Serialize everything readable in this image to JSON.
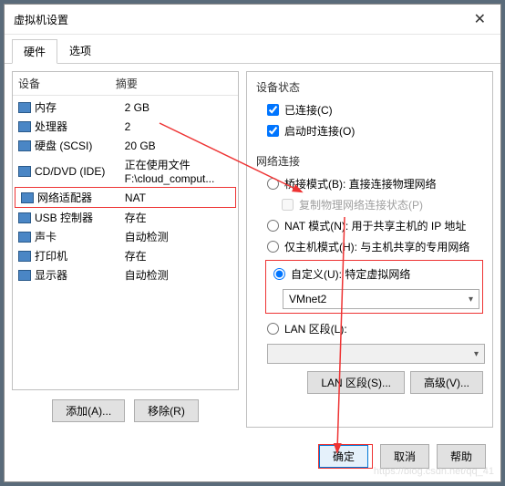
{
  "window": {
    "title": "虚拟机设置"
  },
  "tabs": {
    "hardware": "硬件",
    "options": "选项"
  },
  "listHeaders": {
    "device": "设备",
    "summary": "摘要"
  },
  "devices": [
    {
      "name": "内存",
      "summary": "2 GB"
    },
    {
      "name": "处理器",
      "summary": "2"
    },
    {
      "name": "硬盘 (SCSI)",
      "summary": "20 GB"
    },
    {
      "name": "CD/DVD (IDE)",
      "summary": "正在使用文件 F:\\cloud_comput..."
    },
    {
      "name": "网络适配器",
      "summary": "NAT"
    },
    {
      "name": "USB 控制器",
      "summary": "存在"
    },
    {
      "name": "声卡",
      "summary": "自动检测"
    },
    {
      "name": "打印机",
      "summary": "存在"
    },
    {
      "name": "显示器",
      "summary": "自动检测"
    }
  ],
  "leftActions": {
    "add": "添加(A)...",
    "remove": "移除(R)"
  },
  "right": {
    "statusTitle": "设备状态",
    "connected": "已连接(C)",
    "connectAtPowerOn": "启动时连接(O)",
    "netConnTitle": "网络连接",
    "bridged": "桥接模式(B): 直接连接物理网络",
    "replicate": "复制物理网络连接状态(P)",
    "nat": "NAT 模式(N): 用于共享主机的 IP 地址",
    "hostOnly": "仅主机模式(H): 与主机共享的专用网络",
    "custom": "自定义(U): 特定虚拟网络",
    "vmnetSelected": "VMnet2",
    "lanSegment": "LAN 区段(L):",
    "lanSegBtn": "LAN 区段(S)...",
    "advancedBtn": "高级(V)..."
  },
  "footer": {
    "ok": "确定",
    "cancel": "取消",
    "help": "帮助"
  }
}
